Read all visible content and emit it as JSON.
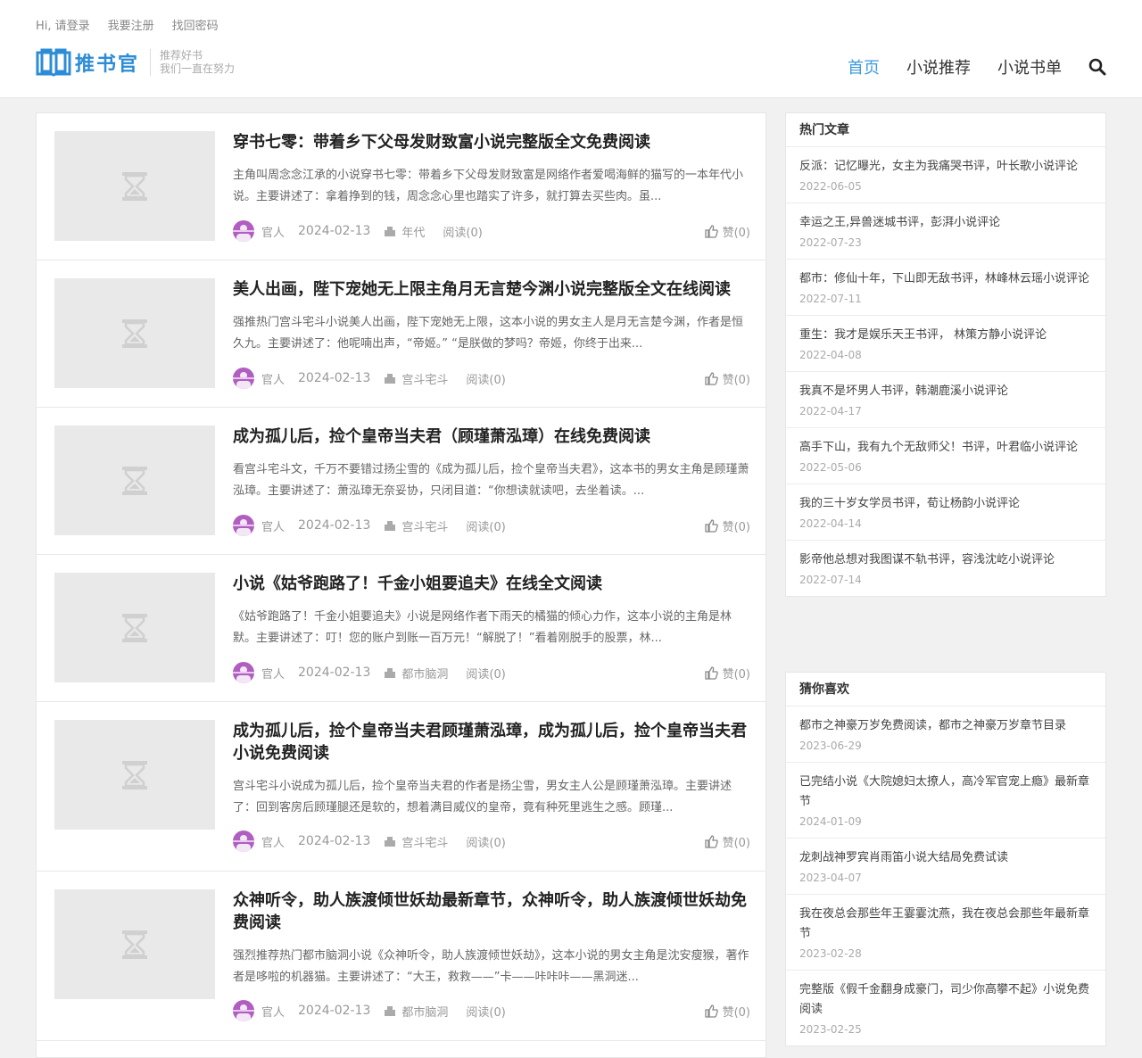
{
  "topbar": {
    "login": "Hi, 请登录",
    "register": "我要注册",
    "recover": "找回密码"
  },
  "logo": {
    "text": "推书官",
    "slogan1": "推荐好书",
    "slogan2": "我们一直在努力"
  },
  "nav": [
    "首页",
    "小说推荐",
    "小说书单"
  ],
  "colors": {
    "accent": "#3b9be0",
    "logo": "#2d8cd6",
    "avatar": "#b05ec0"
  },
  "posts": [
    {
      "title": "穿书七零：带着乡下父母发财致富小说完整版全文免费阅读",
      "excerpt": "主角叫周念念江承的小说穿书七零：带着乡下父母发财致富是网络作者爱喝海鲜的猫写的一本年代小说。主要讲述了：拿着挣到的钱，周念念心里也踏实了许多，就打算去买些肉。虽...",
      "author": "官人",
      "date": "2024-02-13",
      "category": "年代",
      "views": "阅读(0)",
      "likes": "赞(0)"
    },
    {
      "title": "美人出画，陛下宠她无上限主角月无言楚今渊小说完整版全文在线阅读",
      "excerpt": "强推热门宫斗宅斗小说美人出画，陛下宠她无上限，这本小说的男女主人是月无言楚今渊，作者是恒久九。主要讲述了：他呢喃出声，“帝姬。” “是朕做的梦吗？帝姬，你终于出来...",
      "author": "官人",
      "date": "2024-02-13",
      "category": "宫斗宅斗",
      "views": "阅读(0)",
      "likes": "赞(0)"
    },
    {
      "title": "成为孤儿后，捡个皇帝当夫君（顾瑾萧泓璋）在线免费阅读",
      "excerpt": "看宫斗宅斗文，千万不要错过扬尘雪的《成为孤儿后，捡个皇帝当夫君》，这本书的男女主角是顾瑾萧泓璋。主要讲述了：萧泓璋无奈妥协，只闭目道：“你想读就读吧，去坐着读。...",
      "author": "官人",
      "date": "2024-02-13",
      "category": "宫斗宅斗",
      "views": "阅读(0)",
      "likes": "赞(0)"
    },
    {
      "title": "小说《姑爷跑路了！千金小姐要追夫》在线全文阅读",
      "excerpt": "《姑爷跑路了！千金小姐要追夫》小说是网络作者下雨天的橘猫的倾心力作，这本小说的主角是林默。主要讲述了：叮！您的账户到账一百万元！“解脱了！”看着刚脱手的股票，林...",
      "author": "官人",
      "date": "2024-02-13",
      "category": "都市脑洞",
      "views": "阅读(0)",
      "likes": "赞(0)"
    },
    {
      "title": "成为孤儿后，捡个皇帝当夫君顾瑾萧泓璋，成为孤儿后，捡个皇帝当夫君小说免费阅读",
      "excerpt": "宫斗宅斗小说成为孤儿后，捡个皇帝当夫君的作者是扬尘雪，男女主人公是顾瑾萧泓璋。主要讲述了：回到客房后顾瑾腿还是软的，想着满目威仪的皇帝，竟有种死里逃生之感。顾瑾...",
      "author": "官人",
      "date": "2024-02-13",
      "category": "宫斗宅斗",
      "views": "阅读(0)",
      "likes": "赞(0)"
    },
    {
      "title": "众神听令，助人族渡倾世妖劫最新章节，众神听令，助人族渡倾世妖劫免费阅读",
      "excerpt": "强烈推荐热门都市脑洞小说《众神听令，助人族渡倾世妖劫》，这本小说的男女主角是沈安瘦猴，著作者是哆啦的机器猫。主要讲述了：“大王，救救——”卡——咔咔咔——黑洞迷...",
      "author": "官人",
      "date": "2024-02-13",
      "category": "都市脑洞",
      "views": "阅读(0)",
      "likes": "赞(0)"
    }
  ],
  "hot": {
    "title": "热门文章",
    "items": [
      {
        "title": "反派：记忆曝光，女主为我痛哭书评，叶长歌小说评论",
        "date": "2022-06-05"
      },
      {
        "title": "幸运之王,异兽迷城书评，彭湃小说评论",
        "date": "2022-07-23"
      },
      {
        "title": "都市：修仙十年，下山即无敌书评，林峰林云瑶小说评论",
        "date": "2022-07-11"
      },
      {
        "title": "重生：我才是娱乐天王书评， 林策方静小说评论",
        "date": "2022-04-08"
      },
      {
        "title": "我真不是坏男人书评，韩潮鹿溪小说评论",
        "date": "2022-04-17"
      },
      {
        "title": "高手下山，我有九个无敌师父！书评，叶君临小说评论",
        "date": "2022-05-06"
      },
      {
        "title": "我的三十岁女学员书评，荀让杨韵小说评论",
        "date": "2022-04-14"
      },
      {
        "title": "影帝他总想对我图谋不轨书评，容浅沈屹小说评论",
        "date": "2022-07-14"
      }
    ]
  },
  "guess": {
    "title": "猜你喜欢",
    "items": [
      {
        "title": "都市之神豪万岁免费阅读，都市之神豪万岁章节目录",
        "date": "2023-06-29"
      },
      {
        "title": "已完结小说《大院媳妇太撩人，高冷军官宠上瘾》最新章节",
        "date": "2024-01-09"
      },
      {
        "title": "龙刺战神罗宾肖雨笛小说大结局免费试读",
        "date": "2023-04-07"
      },
      {
        "title": "我在夜总会那些年王霎霎沈燕，我在夜总会那些年最新章节",
        "date": "2023-02-28"
      },
      {
        "title": "完整版《假千金翻身成豪门，司少你高攀不起》小说免费阅读",
        "date": "2023-02-25"
      }
    ]
  }
}
